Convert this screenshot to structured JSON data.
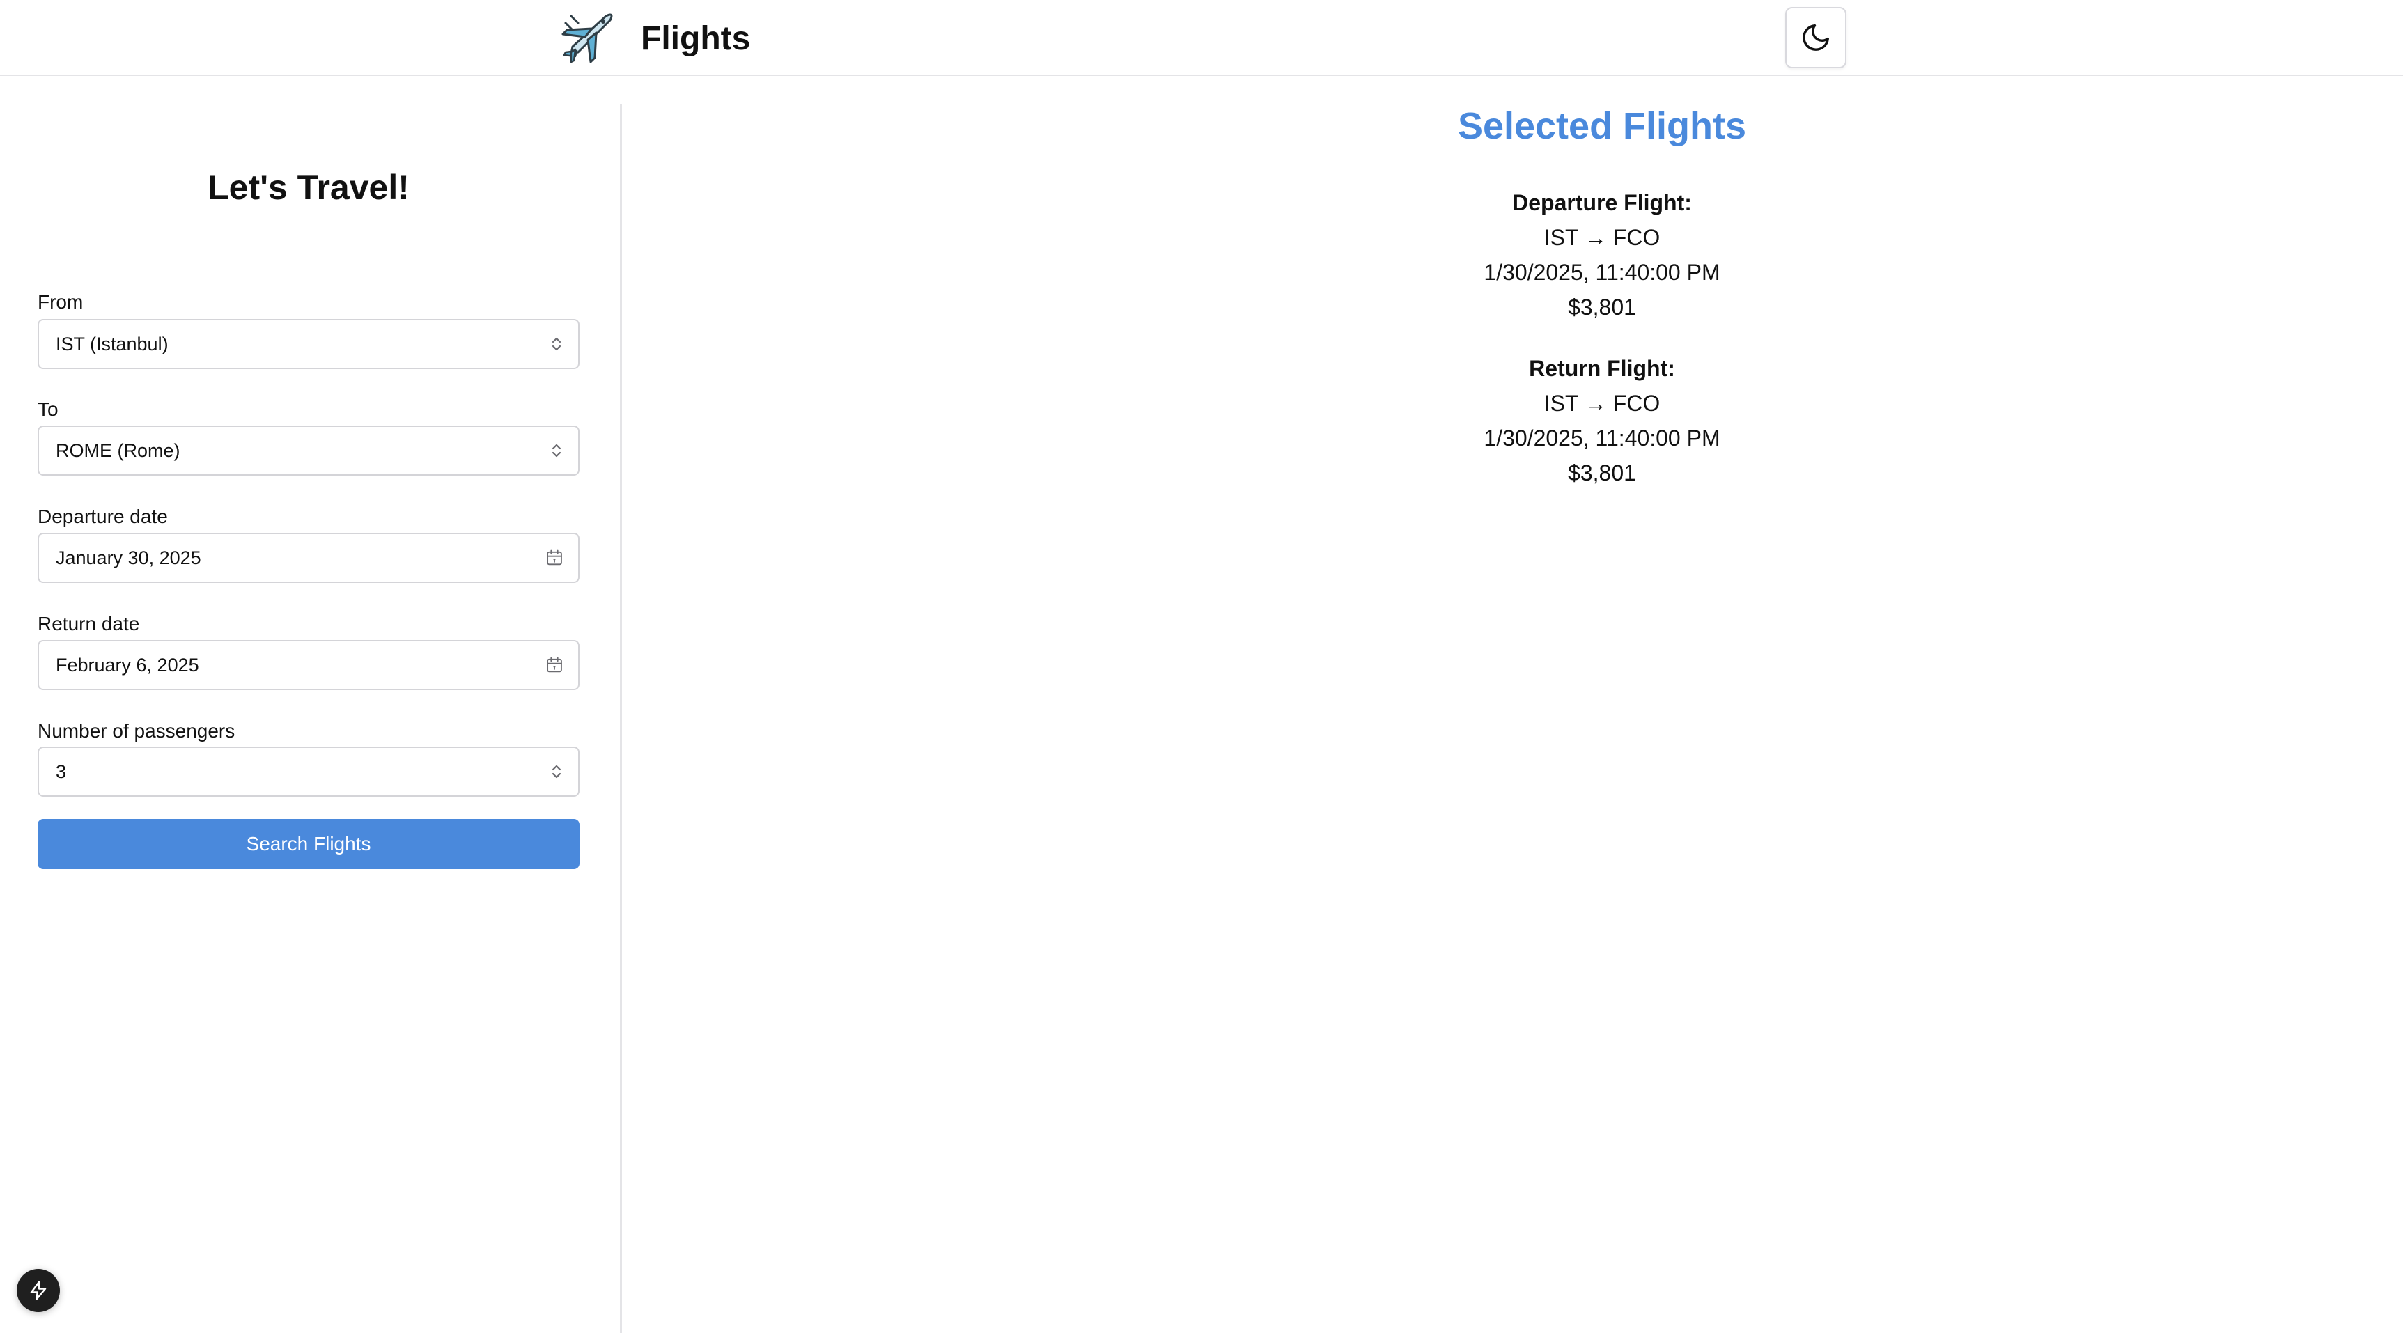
{
  "header": {
    "title": "Flights",
    "logo_icon": "airplane-icon",
    "theme_toggle_icon": "moon-icon"
  },
  "sidebar": {
    "title": "Let's Travel!",
    "from": {
      "label": "From",
      "value": "IST (Istanbul)"
    },
    "to": {
      "label": "To",
      "value": "ROME (Rome)"
    },
    "departure": {
      "label": "Departure date",
      "value": "January 30, 2025"
    },
    "return": {
      "label": "Return date",
      "value": "February 6, 2025"
    },
    "passengers": {
      "label": "Number of passengers",
      "value": "3"
    },
    "search_label": "Search Flights"
  },
  "main": {
    "title": "Selected Flights",
    "departure_flight": {
      "heading": "Departure Flight:",
      "route": "IST → FCO",
      "datetime": "1/30/2025, 11:40:00 PM",
      "price": "$3,801"
    },
    "return_flight": {
      "heading": "Return Flight:",
      "route": "IST → FCO",
      "datetime": "1/30/2025, 11:40:00 PM",
      "price": "$3,801"
    }
  },
  "colors": {
    "accent": "#4a89dc",
    "border": "#d4d4d8",
    "badge": "#1f1f1f"
  }
}
